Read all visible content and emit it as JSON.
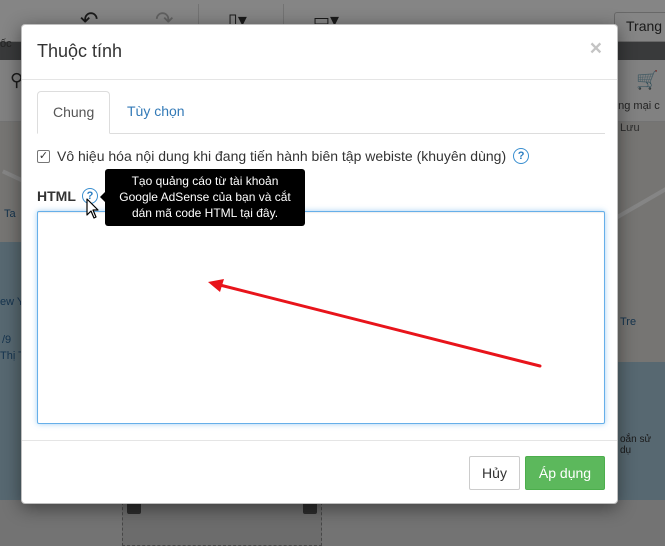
{
  "background": {
    "toolbar_button_trang": "Trang",
    "left_fragment": "ốc",
    "map_labels": [
      "Ta",
      "ew Y",
      "/9",
      "Thị T",
      "Lưu",
      "Tre",
      "oắn sử dụ",
      "ong mại c"
    ]
  },
  "dialog": {
    "title": "Thuộc tính",
    "close_glyph": "×",
    "tabs": [
      {
        "label": "Chung",
        "active": true
      },
      {
        "label": "Tùy chọn",
        "active": false
      }
    ],
    "disable_checkbox": {
      "label": "Vô hiệu hóa nội dung khi đang tiến hành biên tập webiste (khuyên dùng)",
      "checked": true
    },
    "help_glyph": "?",
    "html_label": "HTML",
    "tooltip": "Tạo quảng cáo từ tài khoản Google AdSense của bạn và cắt dán mã code HTML tại đây.",
    "html_value": "",
    "cancel_label": "Hủy",
    "apply_label": "Áp dụng"
  },
  "colors": {
    "primary_link": "#337ab7",
    "apply_button": "#5cb85c",
    "annotation_arrow": "#e8141b",
    "tooltip_bg": "#000000"
  },
  "icons": [
    "undo-icon",
    "redo-icon",
    "page-icon",
    "layout-icon",
    "map-pin-icon",
    "cart-icon",
    "cursor-icon",
    "annotation-arrow"
  ]
}
